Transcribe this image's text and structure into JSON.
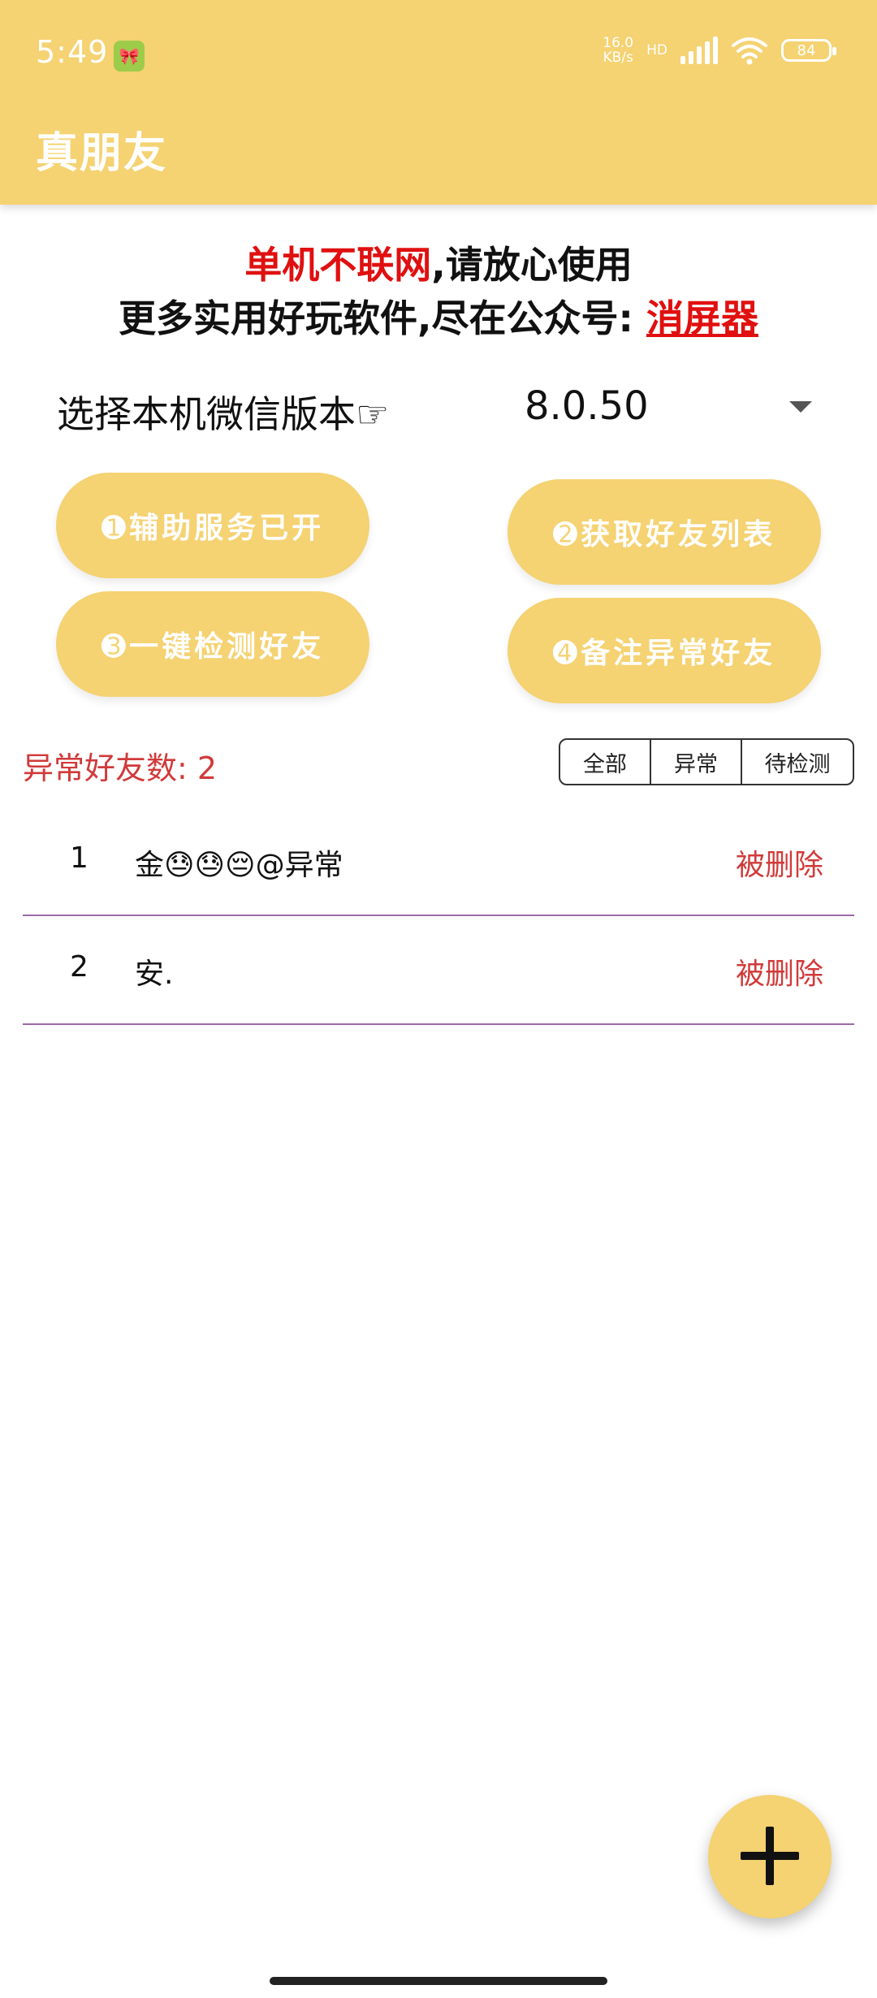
{
  "status_bar": {
    "time": "5:49",
    "net_speed_value": "16.0",
    "net_speed_unit": "KB/s",
    "network_type": "HD",
    "wifi_label": "6",
    "battery": "84"
  },
  "app_bar": {
    "title": "真朋友"
  },
  "notice": {
    "line1_red": "单机不联网",
    "line1_rest": ",请放心使用",
    "line2_prefix": "更多实用好玩软件,尽在公众号: ",
    "line2_link": "消屏器"
  },
  "version": {
    "label": "选择本机微信版本☞",
    "selected": "8.0.50"
  },
  "actions": {
    "btn1": "➊辅助服务已开",
    "btn2": "➋获取好友列表",
    "btn3": "➌一键检测好友",
    "btn4": "➍备注异常好友"
  },
  "summary": {
    "abnormal_count": "异常好友数: 2"
  },
  "filters": {
    "all": "全部",
    "abnormal": "异常",
    "pending": "待检测"
  },
  "friends": [
    {
      "index": "1",
      "name": "金😓😓😔@异常",
      "status": "被删除"
    },
    {
      "index": "2",
      "name": "安.",
      "status": "被删除"
    }
  ],
  "colors": {
    "accent": "#f5d272",
    "alert": "#e01010",
    "status_red": "#d13a3a",
    "divider": "#9b6aa6"
  },
  "icons": {
    "fab": "plus-icon",
    "dropdown": "dropdown-arrow-icon"
  }
}
